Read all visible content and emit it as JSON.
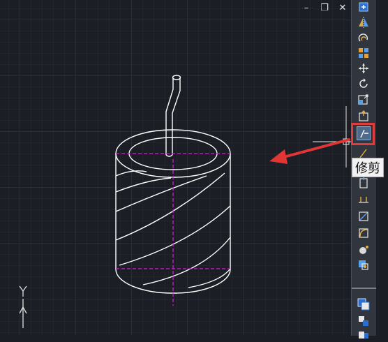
{
  "window_controls": {
    "minimize_glyph": "–",
    "restore_glyph": "❐",
    "close_glyph": "✕"
  },
  "toolbar": {
    "tools": [
      {
        "id": "add",
        "icon": "add-object-icon"
      },
      {
        "id": "mirror",
        "icon": "mirror-icon"
      },
      {
        "id": "offset",
        "icon": "offset-icon"
      },
      {
        "id": "array",
        "icon": "array-icon"
      },
      {
        "id": "move",
        "icon": "move-icon"
      },
      {
        "id": "rotate",
        "icon": "rotate-icon"
      },
      {
        "id": "scale",
        "icon": "scale-icon"
      },
      {
        "id": "stretch",
        "icon": "stretch-icon"
      },
      {
        "id": "trim",
        "icon": "trim-icon",
        "active": true
      },
      {
        "id": "extend",
        "icon": "extend-icon"
      },
      {
        "id": "break",
        "icon": "break-icon"
      },
      {
        "id": "join",
        "icon": "join-icon"
      },
      {
        "id": "chamfer",
        "icon": "chamfer-icon"
      },
      {
        "id": "fillet",
        "icon": "fillet-icon"
      },
      {
        "id": "blend",
        "icon": "blend-curves-icon"
      },
      {
        "id": "explode",
        "icon": "explode-icon"
      },
      {
        "id": "properties",
        "icon": "properties-icon"
      },
      {
        "id": "copy",
        "icon": "copy-icon"
      },
      {
        "id": "paste",
        "icon": "paste-icon"
      }
    ]
  },
  "tooltip": {
    "text": "修剪"
  },
  "ucs": {
    "y_label": "Y"
  },
  "colors": {
    "background": "#1b1e24",
    "grid_minor": "#262a31",
    "grid_major": "#333944",
    "geometry": "#ffffff",
    "center_lines": "#d21fd2",
    "highlight": "#e23b3b",
    "arrow": "#e23535"
  }
}
